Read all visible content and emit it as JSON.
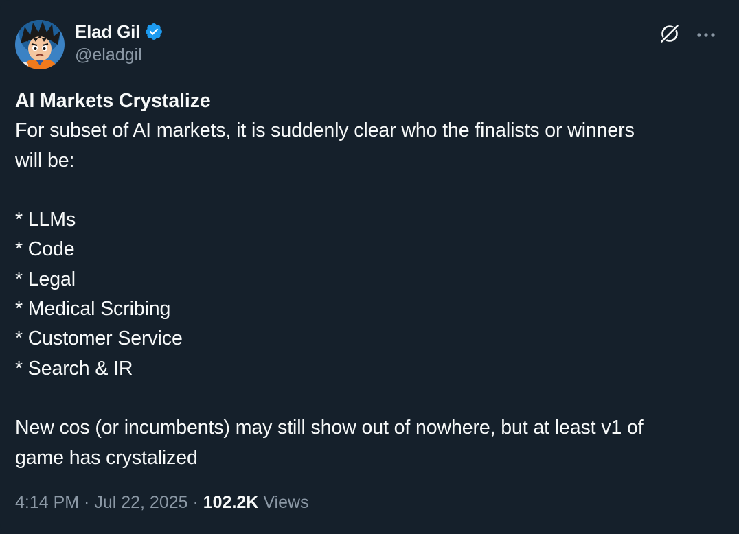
{
  "author": {
    "display_name": "Elad Gil",
    "handle": "@eladgil",
    "verified_icon": "verified-badge-icon",
    "avatar_icon": "avatar-image"
  },
  "actions": {
    "grok_icon": "grok-icon",
    "more_icon": "more-options-icon"
  },
  "post": {
    "title": "AI Markets Crystalize",
    "intro_line1": "For subset of AI markets, it is suddenly clear who the finalists or winners",
    "intro_line2": "will be:",
    "items": [
      "* LLMs",
      "* Code",
      "* Legal",
      "* Medical Scribing",
      "* Customer Service",
      "* Search & IR"
    ],
    "closing_line1": "New cos (or incumbents) may still show out of nowhere, but at least v1 of",
    "closing_line2": "game has crystalized"
  },
  "meta": {
    "time": "4:14 PM",
    "sep1": " · ",
    "date": "Jul 22, 2025",
    "sep2": " · ",
    "views_count": "102.2K",
    "views_label": " Views"
  },
  "colors": {
    "background": "#15202b",
    "text": "#f7f9f9",
    "secondary": "#8b98a5",
    "verified": "#1d9bf0"
  }
}
